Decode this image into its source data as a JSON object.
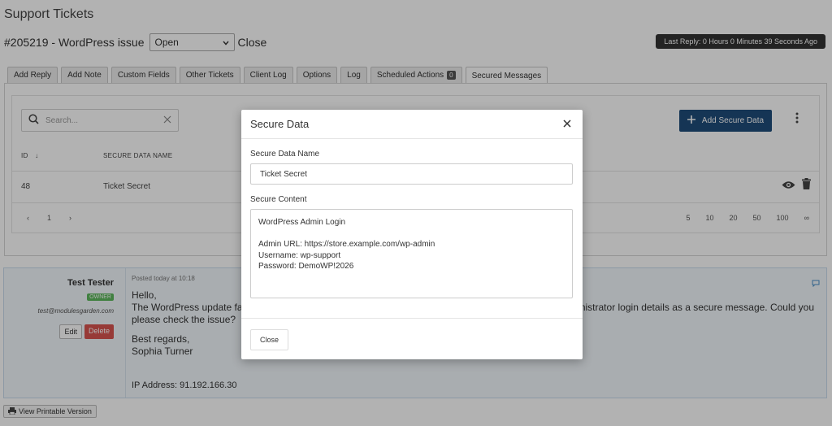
{
  "page": {
    "title": "Support Tickets"
  },
  "ticket": {
    "heading": "#205219 - WordPress issue",
    "status": "Open",
    "close_label": "Close",
    "last_reply": "Last Reply: 0 Hours 0 Minutes 39 Seconds Ago"
  },
  "tabs": [
    {
      "label": "Add Reply"
    },
    {
      "label": "Add Note"
    },
    {
      "label": "Custom Fields"
    },
    {
      "label": "Other Tickets"
    },
    {
      "label": "Client Log"
    },
    {
      "label": "Options"
    },
    {
      "label": "Log"
    },
    {
      "label": "Scheduled Actions",
      "count": "0"
    },
    {
      "label": "Secured Messages",
      "active": true
    }
  ],
  "secured": {
    "search_placeholder": "Search...",
    "add_button": "Add Secure Data",
    "columns": {
      "id": "ID",
      "name": "SECURE DATA NAME"
    },
    "rows": [
      {
        "id": "48",
        "name": "Ticket Secret"
      }
    ],
    "pagination": {
      "current_page": "1",
      "sizes": [
        "5",
        "10",
        "20",
        "50",
        "100",
        "∞"
      ]
    }
  },
  "reply": {
    "author": "Test Tester",
    "role_badge": "OWNER",
    "email": "test@modulesgarden.com",
    "edit_label": "Edit",
    "delete_label": "Delete",
    "posted": "Posted today at 10:18",
    "greeting": "Hello,",
    "body_start": "The WordPress update fails",
    "body_end": "dministrator login details as a secure message. Could you",
    "body_line2": "please check the issue?",
    "signoff": "Best regards,",
    "signature": "Sophia Turner",
    "ip": "IP Address: 91.192.166.30"
  },
  "footer": {
    "print_label": "View Printable Version"
  },
  "modal": {
    "title": "Secure Data",
    "name_label": "Secure Data Name",
    "name_value": "Ticket Secret",
    "content_label": "Secure Content",
    "content_lines": [
      "WordPress Admin Login",
      "",
      "Admin URL: https://store.example.com/wp-admin",
      "Username: wp-support",
      "Password: DemoWP!2026"
    ],
    "close_button": "Close"
  },
  "colors": {
    "primary_button": "#1f4d7a",
    "danger": "#d9534f",
    "owner_badge": "#5cb85c",
    "reply_bg": "#f3f8fc"
  }
}
